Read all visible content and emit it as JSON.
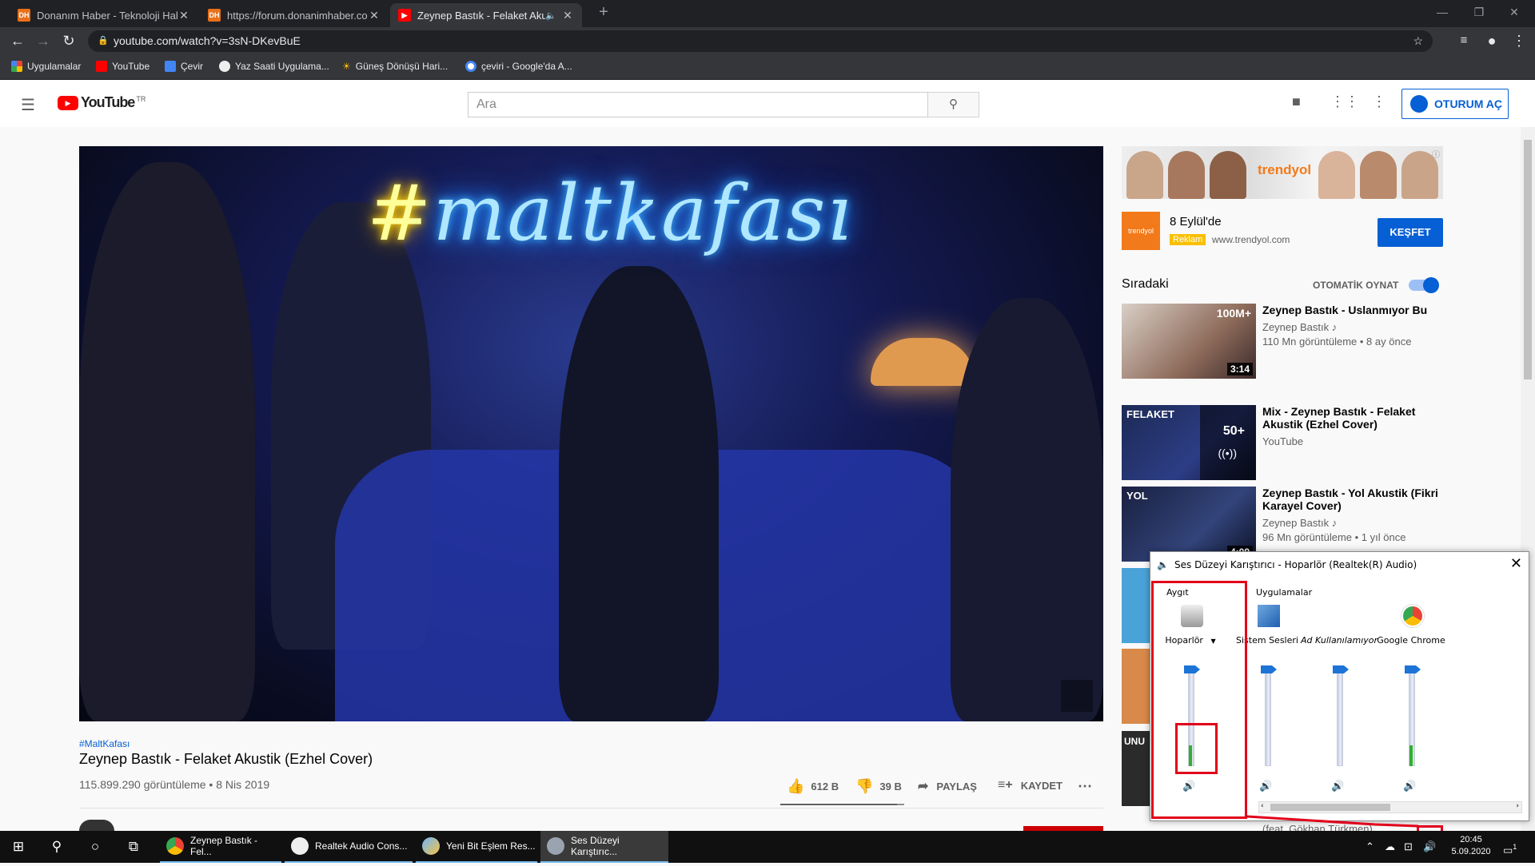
{
  "browser": {
    "tabs": [
      {
        "title": "Donanım Haber - Teknoloji Habe",
        "favicon": "DH"
      },
      {
        "title": "https://forum.donanimhaber.con",
        "favicon": "DH"
      },
      {
        "title": "Zeynep Bastık - Felaket Akusti",
        "favicon": "youtube-icon",
        "active": true
      }
    ],
    "url": "youtube.com/watch?v=3sN-DKevBuE",
    "bookmarks": [
      {
        "label": "Uygulamalar",
        "icon": "apps-grid-icon"
      },
      {
        "label": "YouTube",
        "icon": "youtube-icon"
      },
      {
        "label": "Çevir",
        "icon": "translate-icon"
      },
      {
        "label": "Yaz Saati Uygulama...",
        "icon": "globe-icon"
      },
      {
        "label": "Güneş Dönüşü Hari...",
        "icon": "sun-icon"
      },
      {
        "label": "çeviri - Google'da A...",
        "icon": "google-icon"
      }
    ]
  },
  "youtube": {
    "logo": "YouTube",
    "logo_region": "TR",
    "search_placeholder": "Ara",
    "signin_label": "OTURUM AÇ",
    "video": {
      "neon_hash": "#",
      "neon_text": "maltkafası",
      "hashtag": "#MaltKafası",
      "title": "Zeynep Bastık - Felaket Akustik (Ezhel Cover)",
      "meta": "115.899.290 görüntüleme • 8 Nis 2019",
      "likes": "612 B",
      "dislikes": "39 B",
      "share": "PAYLAŞ",
      "save": "KAYDET",
      "like_ratio": 0.94
    },
    "ad": {
      "banner_logo": "trendyol",
      "logo_text": "trendyol",
      "title": "8 Eylül'de",
      "badge": "Reklam",
      "url": "www.trendyol.com",
      "cta": "KEŞFET"
    },
    "upnext_label": "Sıradaki",
    "autoplay_label": "OTOMATİK OYNAT",
    "recommendations": [
      {
        "title": "Zeynep Bastık - Uslanmıyor Bu",
        "channel": "Zeynep Bastık ♪",
        "meta": "110 Mn görüntüleme • 8 ay önce",
        "duration": "3:14",
        "badge": "100M+"
      },
      {
        "title": "Mix - Zeynep Bastık - Felaket Akustik (Ezhel Cover)",
        "channel": "YouTube",
        "meta": "",
        "duration": "",
        "badge": "50+",
        "thumb_text": "FELAKET"
      },
      {
        "title": "Zeynep Bastık - Yol Akustik (Fikri Karayel Cover)",
        "channel": "Zeynep Bastık ♪",
        "meta": "96 Mn görüntüleme • 1 yıl önce",
        "duration": "4:09",
        "badge": "",
        "thumb_text": "YOL"
      }
    ],
    "partial_rec_text": "(feat. Gökhan Türkmen)",
    "partial_rec_thumb": "UNU"
  },
  "mixer": {
    "title": "Ses Düzeyi Karıştırıcı - Hoparlör (Realtek(R) Audio)",
    "device_group": "Aygıt",
    "apps_group": "Uygulamalar",
    "channels": [
      {
        "name": "Hoparlör",
        "icon": "speaker-device-icon",
        "level": 0.22,
        "has_dropdown": true
      },
      {
        "name": "Sistem Sesleri",
        "icon": "system-sounds-icon",
        "level": 0
      },
      {
        "name": "Ad Kullanılamıyor",
        "icon": "blank-app-icon",
        "level": 0
      },
      {
        "name": "Google Chrome",
        "icon": "chrome-icon",
        "level": 0.22
      }
    ]
  },
  "taskbar": {
    "apps": [
      {
        "label": "Zeynep Bastık - Fel...",
        "icon": "chrome-icon"
      },
      {
        "label": "Realtek Audio Cons...",
        "icon": "realtek-icon"
      },
      {
        "label": "Yeni Bit Eşlem Res...",
        "icon": "paint-icon"
      },
      {
        "label": "Ses Düzeyi Karıştırıc...",
        "icon": "mixer-icon",
        "active": true
      }
    ],
    "time": "20:45",
    "date": "5.09.2020",
    "notification_count": "1"
  }
}
